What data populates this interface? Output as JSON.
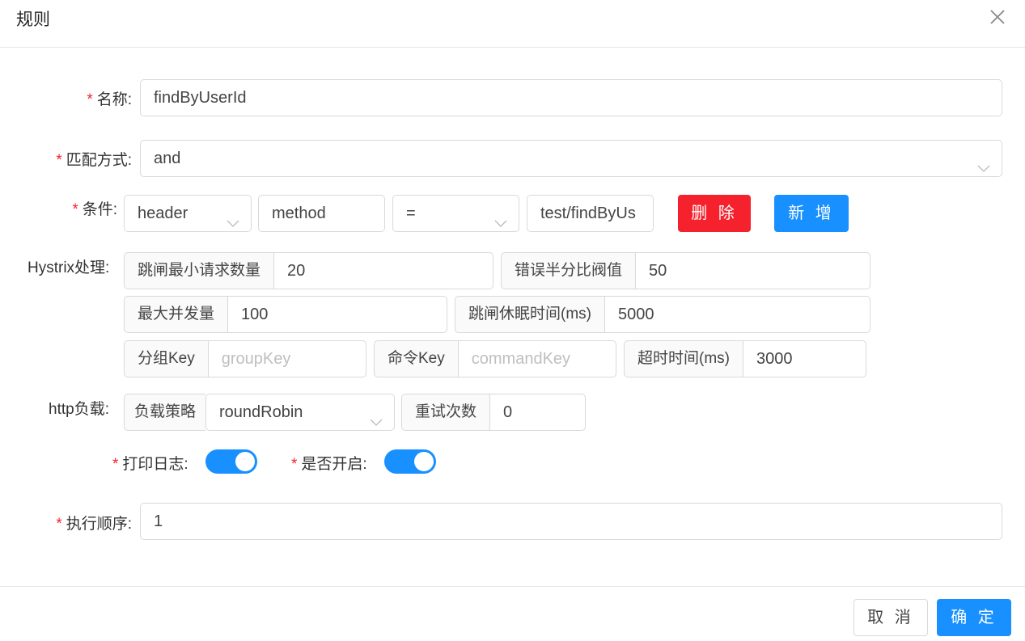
{
  "dialog": {
    "title": "规则",
    "close_icon": "close-icon"
  },
  "colors": {
    "primary": "#1890ff",
    "danger": "#f5222d",
    "required_mark": "#f5222d"
  },
  "form": {
    "name": {
      "label": "名称:",
      "required": "*",
      "value": "findByUserId"
    },
    "match_mode": {
      "label": "匹配方式:",
      "required": "*",
      "value": "and"
    },
    "condition": {
      "label": "条件:",
      "required": "*",
      "type": "header",
      "key": "method",
      "operator": "=",
      "value": "test/findByUs",
      "delete_label": "删 除",
      "add_label": "新 增"
    },
    "hystrix": {
      "label": "Hystrix处理:",
      "fields": [
        {
          "label": "跳闸最小请求数量",
          "value": "20"
        },
        {
          "label": "错误半分比阀值",
          "value": "50"
        },
        {
          "label": "最大并发量",
          "value": "100"
        },
        {
          "label": "跳闸休眠时间(ms)",
          "value": "5000"
        },
        {
          "label": "分组Key",
          "value": "",
          "placeholder": "groupKey"
        },
        {
          "label": "命令Key",
          "value": "",
          "placeholder": "commandKey"
        },
        {
          "label": "超时时间(ms)",
          "value": "3000"
        }
      ]
    },
    "http_load": {
      "label": "http负载:",
      "strategy_label": "负载策略",
      "strategy_value": "roundRobin",
      "retry_label": "重试次数",
      "retry_value": "0"
    },
    "log_switch": {
      "label": "打印日志:",
      "required": "*",
      "on": true
    },
    "enable_switch": {
      "label": "是否开启:",
      "required": "*",
      "on": true
    },
    "order": {
      "label": "执行顺序:",
      "required": "*",
      "value": "1"
    }
  },
  "footer": {
    "cancel_label": "取 消",
    "ok_label": "确 定"
  }
}
